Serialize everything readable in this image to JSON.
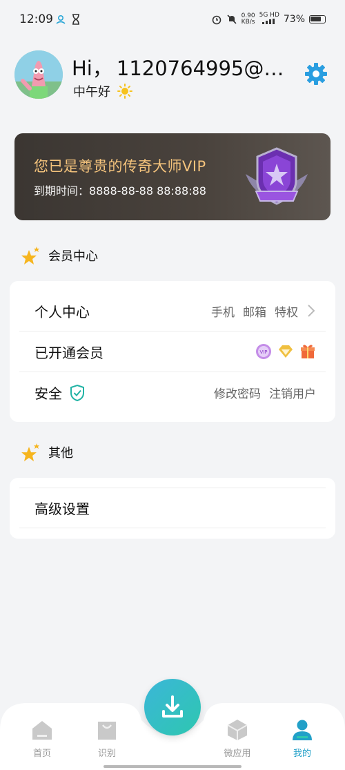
{
  "status_bar": {
    "time": "12:09",
    "net_speed_value": "0.90",
    "net_speed_unit": "KB/s",
    "network": "5G HD",
    "battery": "73%"
  },
  "profile": {
    "hi": "Hi，",
    "account": "1120764995@q…",
    "subgreeting": "中午好"
  },
  "vip": {
    "title": "您已是尊贵的传奇大师VIP",
    "expire_label": "到期时间：",
    "expire_value": "8888-88-88 88:88:88"
  },
  "sections": {
    "member_center": "会员中心",
    "others": "其他"
  },
  "member_rows": {
    "personal": {
      "label": "个人中心",
      "links": [
        "手机",
        "邮箱",
        "特权"
      ]
    },
    "opened": {
      "label": "已开通会员"
    },
    "security": {
      "label": "安全",
      "change_pwd": "修改密码",
      "delete_user": "注销用户"
    }
  },
  "other_rows": {
    "advanced": "高级设置"
  },
  "nav": {
    "home": "首页",
    "recognize": "识别",
    "micro_apps": "微应用",
    "mine": "我的"
  },
  "colors": {
    "accent": "#22a0c8",
    "vip_gold": "#f4c37c",
    "star": "#f6b51e",
    "fab_start": "#3bb6d8",
    "fab_end": "#2ec7b0"
  }
}
